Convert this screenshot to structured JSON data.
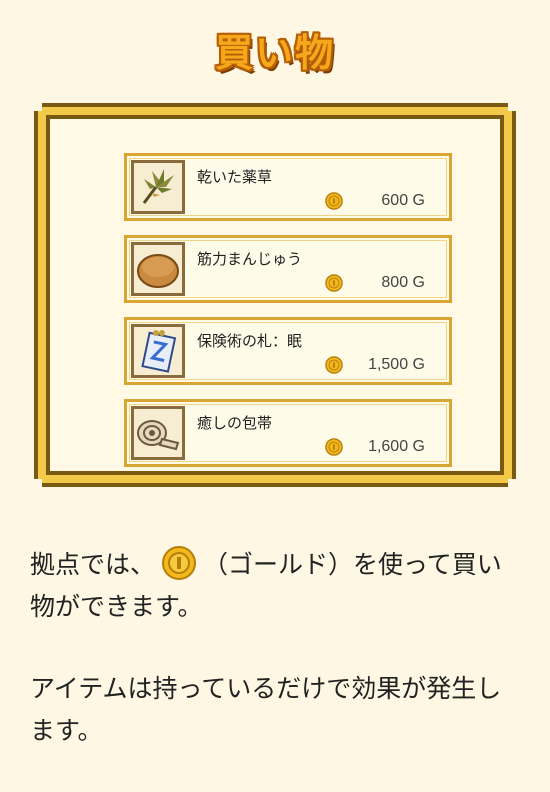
{
  "title": "買い物",
  "items": [
    {
      "name": "乾いた薬草",
      "price": "600 G",
      "icon": "dried-herb-icon"
    },
    {
      "name": "筋力まんじゅう",
      "price": "800 G",
      "icon": "bun-icon"
    },
    {
      "name": "保険術の札：眠",
      "price": "1,500 G",
      "icon": "sleep-talisman-icon"
    },
    {
      "name": "癒しの包帯",
      "price": "1,600 G",
      "icon": "bandage-icon"
    }
  ],
  "description": {
    "p1_before": "拠点では、",
    "p1_after": "（ゴールド）を使って買い物ができます。",
    "p2": "アイテムは持っているだけで効果が発生します。"
  },
  "colors": {
    "background": "#fdf7e3",
    "frame": "#f3c94a",
    "frame_border": "#7a5a12",
    "title": "#f6a71a",
    "coin": "#f2b81c"
  }
}
